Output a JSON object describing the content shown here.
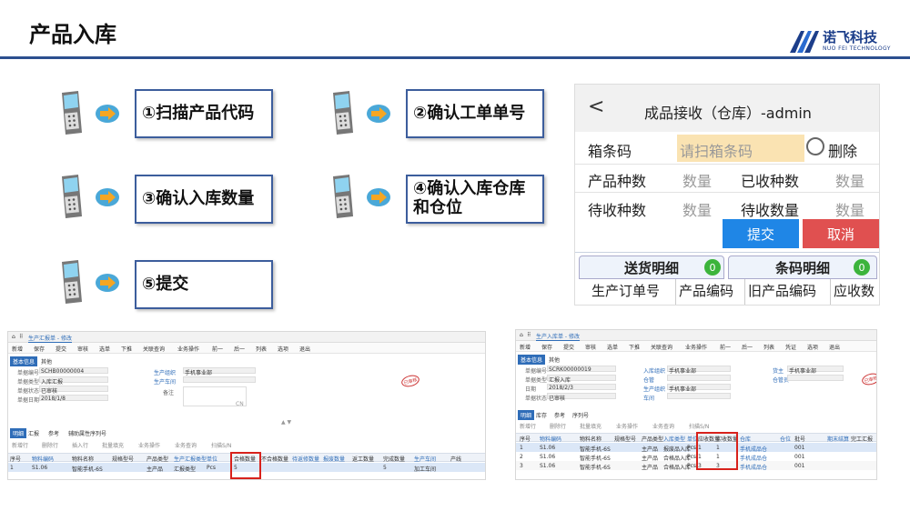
{
  "title": "产品入库",
  "logo": {
    "cn": "诺飞科技",
    "en": "NUO FEI TECHNOLOGY"
  },
  "steps": [
    "①扫描产品代码",
    "②确认工单单号",
    "③确认入库数量",
    "④确认入库仓库和仓位",
    "⑤提交"
  ],
  "mobile": {
    "back": "<",
    "title": "成品接收（仓库）-admin",
    "box_code_label": "箱条码",
    "box_code_placeholder": "请扫箱条码",
    "delete_label": "删除",
    "product_kinds_label": "产品种数",
    "product_kinds_value": "数量",
    "received_kinds_label": "已收种数",
    "received_kinds_value": "数量",
    "pending_kinds_label": "待收种数",
    "pending_kinds_value": "数量",
    "pending_qty_label": "待收数量",
    "pending_qty_value": "数量",
    "submit": "提交",
    "cancel": "取消",
    "tab_delivery": "送货明细",
    "tab_delivery_count": "0",
    "tab_barcode": "条码明细",
    "tab_barcode_count": "0",
    "columns": [
      "生产订单号",
      "产品编码",
      "旧产品编码",
      "应收数"
    ]
  },
  "erp1": {
    "tab": "生产汇报单 - 修改",
    "toolbar": [
      "新增",
      "保存",
      "提交",
      "审核",
      "选单",
      "下推",
      "关联查询",
      "业务操作",
      "前一",
      "后一",
      "列表",
      "选项",
      "退出"
    ],
    "form_tabs": [
      "基本信息",
      "其他"
    ],
    "fields": [
      {
        "label": "单据编号",
        "value": "SCHB00000004"
      },
      {
        "label": "单据类型",
        "value": "入库汇报"
      },
      {
        "label": "单据状态",
        "value": "已审核"
      },
      {
        "label": "单据日期",
        "value": "2018/1/8"
      }
    ],
    "org_label": "生产组织",
    "org_value": "手机事业部",
    "workshop_label": "生产车间",
    "remark_label": "备注",
    "remark_value": "CN",
    "seal": "已审核",
    "detail_tabs": [
      "明细",
      "汇报",
      "参考",
      "辅助属性序列号"
    ],
    "detail_ops": [
      "新增行",
      "删除行",
      "插入行",
      "批量填充",
      "业务操作",
      "业务查询",
      "扫描S/N"
    ],
    "grid_headers": [
      "序号",
      "物料编码",
      "物料名称",
      "规格型号",
      "产品类型",
      "生产汇报类型",
      "单位",
      "合格数量",
      "不合格数量",
      "待返修数量",
      "报废数量",
      "返工数量",
      "完成数量",
      "生产车间",
      "产线"
    ],
    "row": [
      "1",
      "S1.06",
      "智能手机-6S",
      "",
      "主产品",
      "汇报类型",
      "Pcs",
      "5",
      "",
      "",
      "",
      "",
      "5",
      "加工车间",
      ""
    ]
  },
  "erp2": {
    "tab": "生产入库单 - 修改",
    "toolbar": [
      "新增",
      "保存",
      "提交",
      "审核",
      "选单",
      "下推",
      "关联查询",
      "业务操作",
      "前一",
      "后一",
      "列表",
      "凭证",
      "选项",
      "退出"
    ],
    "form_tabs": [
      "基本信息",
      "其他"
    ],
    "fields": [
      {
        "label": "单据编号",
        "value": "SCRK00000019"
      },
      {
        "label": "单据类型",
        "value": "汇报入库"
      },
      {
        "label": "日期",
        "value": "2018/2/3"
      },
      {
        "label": "单据状态",
        "value": "已审核"
      }
    ],
    "org_labels": [
      "入库组织",
      "仓管",
      "生产组织",
      "车间"
    ],
    "org_value": "手机事业部",
    "right_labels": [
      "货主",
      "仓管员"
    ],
    "right_value": "手机事业部",
    "seal": "已审核",
    "detail_tabs": [
      "明细",
      "库存",
      "参考",
      "序列号"
    ],
    "detail_ops": [
      "新增行",
      "删除行",
      "批量填充",
      "业务操作",
      "业务查询",
      "扫描S/N"
    ],
    "grid_headers": [
      "序号",
      "物料编码",
      "物料名称",
      "规格型号",
      "产品类型",
      "入库类型",
      "单位",
      "应收数量",
      "实收数量",
      "仓库",
      "仓位",
      "批号",
      "",
      "期末结算",
      "完工汇报"
    ],
    "rows": [
      [
        "1",
        "S1.06",
        "智能手机-6S",
        "",
        "主产品",
        "报废品入库",
        "Pcs",
        "1",
        "1",
        "手机成品仓",
        "",
        "001"
      ],
      [
        "2",
        "S1.06",
        "智能手机-6S",
        "",
        "主产品",
        "合格品入库",
        "Pcs",
        "1",
        "1",
        "手机成品仓",
        "",
        "001"
      ],
      [
        "3",
        "S1.06",
        "智能手机-6S",
        "",
        "主产品",
        "合格品入库",
        "Pcs",
        "3",
        "3",
        "手机成品仓",
        "",
        "001"
      ]
    ]
  }
}
